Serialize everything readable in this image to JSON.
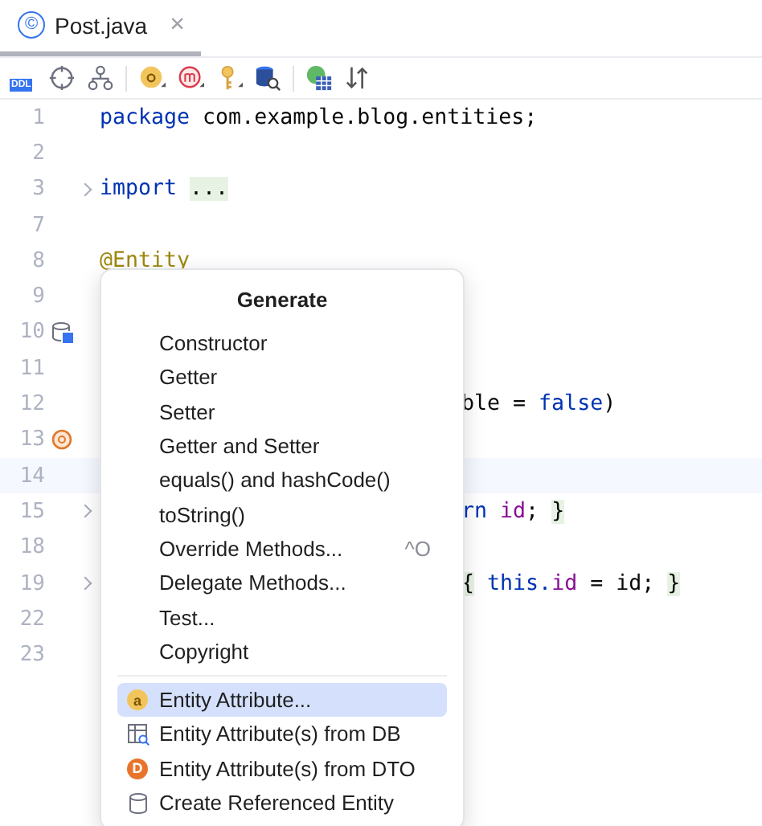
{
  "tab": {
    "icon": "©",
    "title": "Post.java",
    "close": "×",
    "selected": true
  },
  "toolbar": {
    "ddl_label": "DDL"
  },
  "lines": [
    {
      "num": "1",
      "kind": "code",
      "tokens": [
        {
          "t": "package ",
          "kind": "keyword"
        },
        {
          "t": "com.example.blog.entities;",
          "kind": "plain"
        }
      ]
    },
    {
      "num": "2",
      "kind": "empty"
    },
    {
      "num": "3",
      "kind": "code",
      "fold": true,
      "tokens": [
        {
          "t": "import ",
          "kind": "keyword"
        },
        {
          "t": "...",
          "kind": "folded"
        }
      ]
    },
    {
      "num": "7",
      "kind": "empty"
    },
    {
      "num": "8",
      "kind": "code",
      "tokens": [
        {
          "t": "@Entity",
          "kind": "annotation"
        }
      ]
    },
    {
      "num": "9",
      "kind": "empty"
    },
    {
      "num": "10",
      "kind": "db"
    },
    {
      "num": "11",
      "kind": "empty"
    },
    {
      "num": "12",
      "kind": "fragment",
      "tokens": [
        {
          "t": "ble = ",
          "kind": "plain"
        },
        {
          "t": "false",
          "kind": "keyword"
        },
        {
          "t": ")",
          "kind": "plain"
        }
      ]
    },
    {
      "num": "13",
      "kind": "bean"
    },
    {
      "num": "14",
      "kind": "empty",
      "current": true
    },
    {
      "num": "15",
      "kind": "fragment",
      "fold": true,
      "tokens": [
        {
          "t": "rn ",
          "kind": "keyword"
        },
        {
          "t": "id",
          "kind": "field"
        },
        {
          "t": "; ",
          "kind": "plain"
        },
        {
          "t": "}",
          "kind": "folded"
        }
      ]
    },
    {
      "num": "18",
      "kind": "empty"
    },
    {
      "num": "19",
      "kind": "fragment",
      "fold": true,
      "tokens": [
        {
          "t": "{",
          "kind": "folded"
        },
        {
          "t": " this.",
          "kind": "keyword"
        },
        {
          "t": "id",
          "kind": "field"
        },
        {
          "t": " = id; ",
          "kind": "plain"
        },
        {
          "t": "}",
          "kind": "folded"
        }
      ]
    },
    {
      "num": "22",
      "kind": "empty"
    },
    {
      "num": "23",
      "kind": "empty"
    }
  ],
  "popup": {
    "title": "Generate",
    "items": [
      {
        "label": "Constructor",
        "kind": "plain",
        "selected": false
      },
      {
        "label": "Getter",
        "kind": "plain",
        "selected": false
      },
      {
        "label": "Setter",
        "kind": "plain",
        "selected": false
      },
      {
        "label": "Getter and Setter",
        "kind": "plain",
        "selected": false
      },
      {
        "label": "equals() and hashCode()",
        "kind": "plain",
        "selected": false
      },
      {
        "label": "toString()",
        "kind": "plain",
        "selected": false
      },
      {
        "label": "Override Methods...",
        "kind": "plain",
        "shortcut": "^O",
        "selected": false
      },
      {
        "label": "Delegate Methods...",
        "kind": "plain",
        "selected": false
      },
      {
        "label": "Test...",
        "kind": "plain",
        "selected": false
      },
      {
        "label": "Copyright",
        "kind": "plain",
        "selected": false
      },
      {
        "label": "Entity Attribute...",
        "kind": "attribute",
        "icon_text": "a",
        "selected": true,
        "separator": true
      },
      {
        "label": "Entity Attribute(s) from DB",
        "kind": "table",
        "selected": false
      },
      {
        "label": "Entity Attribute(s) from DTO",
        "kind": "dto",
        "icon_text": "D",
        "selected": false
      },
      {
        "label": "Create Referenced Entity",
        "kind": "db",
        "selected": false
      }
    ]
  }
}
